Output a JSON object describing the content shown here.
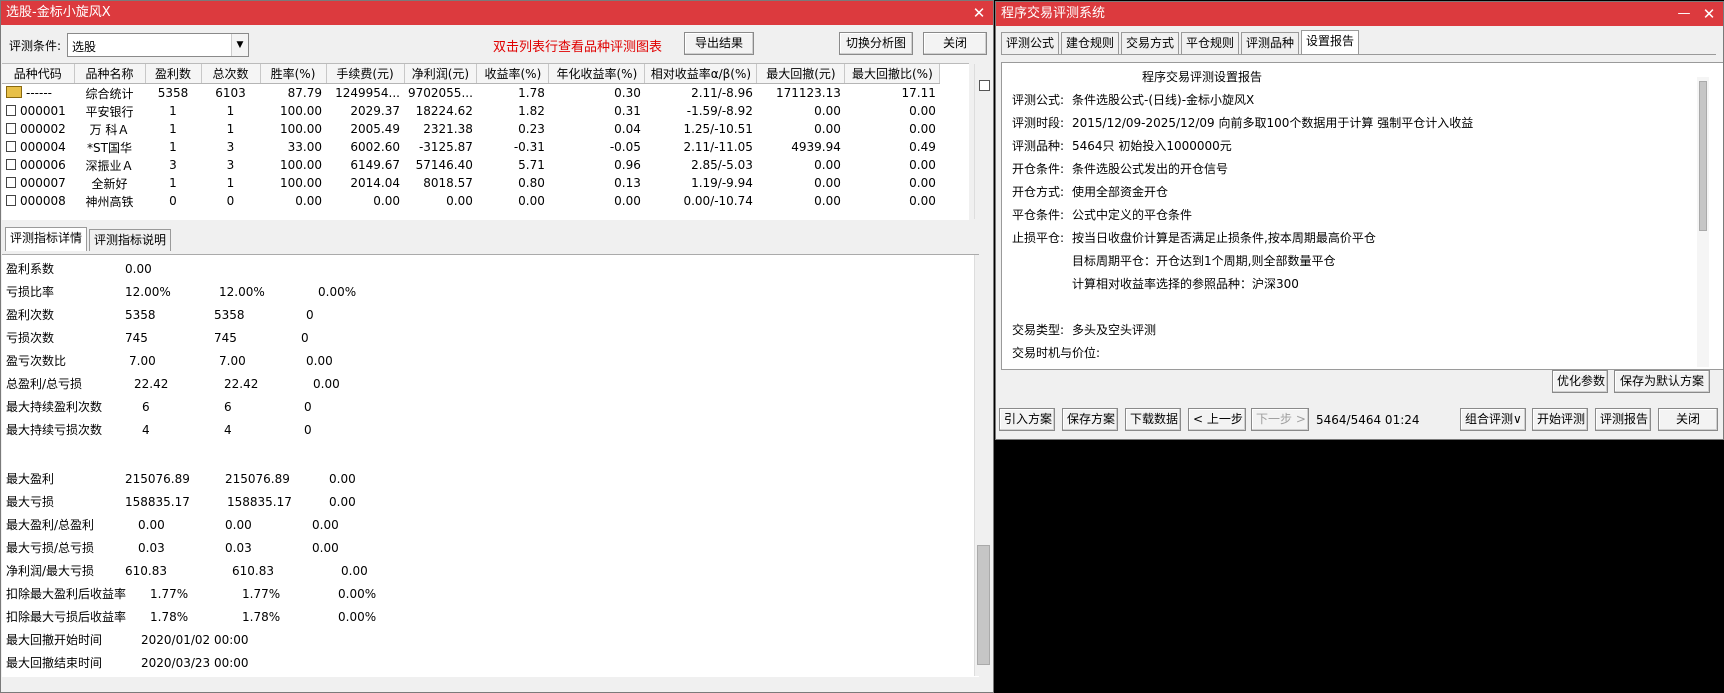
{
  "left_window": {
    "title": "选股-金标小旋风X",
    "condition_label": "评测条件:",
    "condition_value": "选股",
    "hint": "双击列表行查看品种评测图表",
    "buttons": {
      "export": "导出结果",
      "switch": "切换分析图",
      "close": "关闭"
    },
    "columns": [
      "品种代码",
      "品种名称",
      "盈利数",
      "总次数",
      "胜率(%)",
      "手续费(元)",
      "净利润(元)",
      "收益率(%)",
      "年化收益率(%)",
      "相对收益率α/β(%)",
      "最大回撤(元)",
      "最大回撤比(%)"
    ],
    "rows": [
      [
        "------",
        "综合统计",
        "5358",
        "6103",
        "87.79",
        "1249954...",
        "9702055...",
        "1.78",
        "0.30",
        "2.11/-8.96",
        "171123.13",
        "17.11"
      ],
      [
        "000001",
        "平安银行",
        "1",
        "1",
        "100.00",
        "2029.37",
        "18224.62",
        "1.82",
        "0.31",
        "-1.59/-8.92",
        "0.00",
        "0.00"
      ],
      [
        "000002",
        "万 科Ａ",
        "1",
        "1",
        "100.00",
        "2005.49",
        "2321.38",
        "0.23",
        "0.04",
        "1.25/-10.51",
        "0.00",
        "0.00"
      ],
      [
        "000004",
        "*ST国华",
        "1",
        "3",
        "33.00",
        "6002.60",
        "-3125.87",
        "-0.31",
        "-0.05",
        "2.11/-11.05",
        "4939.94",
        "0.49"
      ],
      [
        "000006",
        "深振业Ａ",
        "3",
        "3",
        "100.00",
        "6149.67",
        "57146.40",
        "5.71",
        "0.96",
        "2.85/-5.03",
        "0.00",
        "0.00"
      ],
      [
        "000007",
        "全新好",
        "1",
        "1",
        "100.00",
        "2014.04",
        "8018.57",
        "0.80",
        "0.13",
        "1.19/-9.94",
        "0.00",
        "0.00"
      ],
      [
        "000008",
        "神州高铁",
        "0",
        "0",
        "0.00",
        "0.00",
        "0.00",
        "0.00",
        "0.00",
        "0.00/-10.74",
        "0.00",
        "0.00"
      ]
    ],
    "tabs": [
      "评测指标详情",
      "评测指标说明"
    ],
    "details": [
      {
        "label": "盈利系数",
        "v1": "0.00",
        "v2": "",
        "v3": ""
      },
      {
        "label": "亏损比率",
        "v1": "12.00%",
        "v2": "12.00%",
        "v3": "0.00%"
      },
      {
        "label": "盈利次数",
        "v1": "5358",
        "v2": "5358",
        "v3": "0"
      },
      {
        "label": "亏损次数",
        "v1": "745",
        "v2": "745",
        "v3": "0"
      },
      {
        "label": "盈亏次数比",
        "v1": "7.00",
        "v2": "7.00",
        "v3": "0.00"
      },
      {
        "label": "总盈利/总亏损",
        "v1": "22.42",
        "v2": "22.42",
        "v3": "0.00"
      },
      {
        "label": "最大持续盈利次数",
        "v1": "6",
        "v2": "6",
        "v3": "0"
      },
      {
        "label": "最大持续亏损次数",
        "v1": "4",
        "v2": "4",
        "v3": "0"
      },
      {
        "label": "最大盈利",
        "v1": "215076.89",
        "v2": "215076.89",
        "v3": "0.00"
      },
      {
        "label": "最大亏损",
        "v1": "158835.17",
        "v2": "158835.17",
        "v3": "0.00"
      },
      {
        "label": "最大盈利/总盈利",
        "v1": "0.00",
        "v2": "0.00",
        "v3": "0.00"
      },
      {
        "label": "最大亏损/总亏损",
        "v1": "0.03",
        "v2": "0.03",
        "v3": "0.00"
      },
      {
        "label": "净利润/最大亏损",
        "v1": "610.83",
        "v2": "610.83",
        "v3": "0.00"
      },
      {
        "label": "扣除最大盈利后收益率",
        "v1": "1.77%",
        "v2": "1.77%",
        "v3": "0.00%"
      },
      {
        "label": "扣除最大亏损后收益率",
        "v1": "1.78%",
        "v2": "1.78%",
        "v3": "0.00%"
      },
      {
        "label": "最大回撤开始时间",
        "v1": "2020/01/02 00:00",
        "v2": "",
        "v3": ""
      },
      {
        "label": "最大回撤结束时间",
        "v1": "2020/03/23 00:00",
        "v2": "",
        "v3": ""
      }
    ]
  },
  "right_window": {
    "title": "程序交易评测系统",
    "tabs": [
      "评测公式",
      "建仓规则",
      "交易方式",
      "平仓规则",
      "评测品种",
      "设置报告"
    ],
    "report_title": "程序交易评测设置报告",
    "report_lines": [
      {
        "label": "评测公式:",
        "text": "条件选股公式-(日线)-金标小旋风X"
      },
      {
        "label": "评测时段:",
        "text": "2015/12/09-2025/12/09 向前多取100个数据用于计算 强制平仓计入收益"
      },
      {
        "label": "评测品种:",
        "text": "5464只 初始投入1000000元"
      },
      {
        "label": "开仓条件:",
        "text": "条件选股公式发出的开仓信号"
      },
      {
        "label": "开仓方式:",
        "text": "使用全部资金开仓"
      },
      {
        "label": "平仓条件:",
        "text": "公式中定义的平仓条件"
      },
      {
        "label": "止损平仓:",
        "text": "按当日收盘价计算是否满足止损条件,按本周期最高价平仓"
      },
      {
        "label": "",
        "text": "目标周期平仓：开仓达到1个周期,则全部数量平仓"
      },
      {
        "label": "",
        "text": "计算相对收益率选择的参照品种：沪深300"
      },
      {
        "label": "",
        "text": ""
      },
      {
        "label": "交易类型:",
        "text": "多头及空头评测"
      },
      {
        "label": "交易时机与价位:",
        "text": ""
      }
    ],
    "buttons": {
      "optimize": "优化参数",
      "save_default": "保存为默认方案",
      "import": "引入方案",
      "save": "保存方案",
      "download": "下载数据",
      "prev": "< 上一步",
      "next": "下一步 >",
      "combo": "组合评测∨",
      "start": "开始评测",
      "report": "评测报告",
      "close": "关闭"
    },
    "status": "5464/5464 01:24"
  }
}
